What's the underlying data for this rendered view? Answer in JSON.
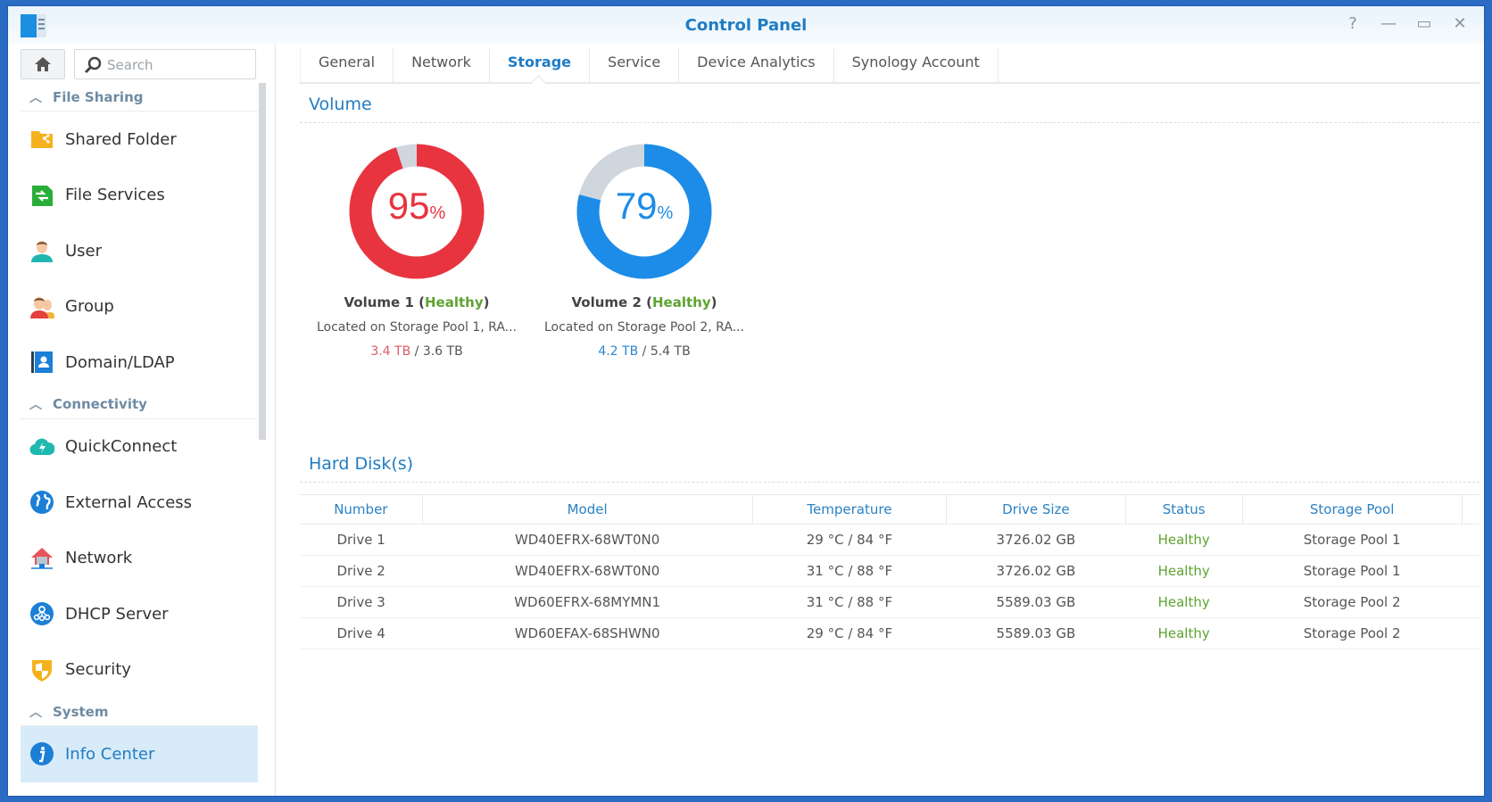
{
  "window": {
    "title": "Control Panel",
    "controls": [
      "help",
      "minimize",
      "maximize",
      "close"
    ]
  },
  "sidebar": {
    "search_placeholder": "Search",
    "groups": [
      {
        "label": "File Sharing",
        "items": [
          {
            "label": "Shared Folder",
            "icon": "shared-folder-icon"
          },
          {
            "label": "File Services",
            "icon": "file-services-icon"
          },
          {
            "label": "User",
            "icon": "user-icon"
          },
          {
            "label": "Group",
            "icon": "group-icon"
          },
          {
            "label": "Domain/LDAP",
            "icon": "domain-ldap-icon"
          }
        ]
      },
      {
        "label": "Connectivity",
        "items": [
          {
            "label": "QuickConnect",
            "icon": "quickconnect-icon"
          },
          {
            "label": "External Access",
            "icon": "globe-icon"
          },
          {
            "label": "Network",
            "icon": "network-house-icon"
          },
          {
            "label": "DHCP Server",
            "icon": "dhcp-icon"
          },
          {
            "label": "Security",
            "icon": "shield-icon"
          }
        ]
      },
      {
        "label": "System",
        "items": [
          {
            "label": "Info Center",
            "icon": "info-icon",
            "active": true
          }
        ]
      }
    ]
  },
  "tabs": [
    {
      "label": "General"
    },
    {
      "label": "Network"
    },
    {
      "label": "Storage",
      "active": true
    },
    {
      "label": "Service"
    },
    {
      "label": "Device Analytics"
    },
    {
      "label": "Synology Account"
    }
  ],
  "volume_section": {
    "title": "Volume",
    "volumes": [
      {
        "percent": 95,
        "percent_label": "95",
        "name": "Volume 1",
        "status": "Healthy",
        "location": "Located on Storage Pool 1, RA...",
        "used": "3.4 TB",
        "total": "3.6 TB",
        "color": "#e8343f"
      },
      {
        "percent": 79,
        "percent_label": "79",
        "name": "Volume 2",
        "status": "Healthy",
        "location": "Located on Storage Pool 2, RA...",
        "used": "4.2 TB",
        "total": "5.4 TB",
        "color": "#1c8ce8"
      }
    ]
  },
  "disks_section": {
    "title": "Hard Disk(s)",
    "columns": [
      "Number",
      "Model",
      "Temperature",
      "Drive Size",
      "Status",
      "Storage Pool"
    ],
    "rows": [
      [
        "Drive 1",
        "WD40EFRX-68WT0N0",
        "29 °C / 84 °F",
        "3726.02 GB",
        "Healthy",
        "Storage Pool 1"
      ],
      [
        "Drive 2",
        "WD40EFRX-68WT0N0",
        "31 °C / 88 °F",
        "3726.02 GB",
        "Healthy",
        "Storage Pool 1"
      ],
      [
        "Drive 3",
        "WD60EFRX-68MYMN1",
        "31 °C / 88 °F",
        "5589.03 GB",
        "Healthy",
        "Storage Pool 2"
      ],
      [
        "Drive 4",
        "WD60EFAX-68SHWN0",
        "29 °C / 84 °F",
        "5589.03 GB",
        "Healthy",
        "Storage Pool 2"
      ]
    ]
  },
  "colors": {
    "accent": "#1f7cc4",
    "healthy": "#5ea331",
    "volume1": "#e8343f",
    "volume2": "#1c8ce8",
    "free": "#cfd6dd"
  }
}
